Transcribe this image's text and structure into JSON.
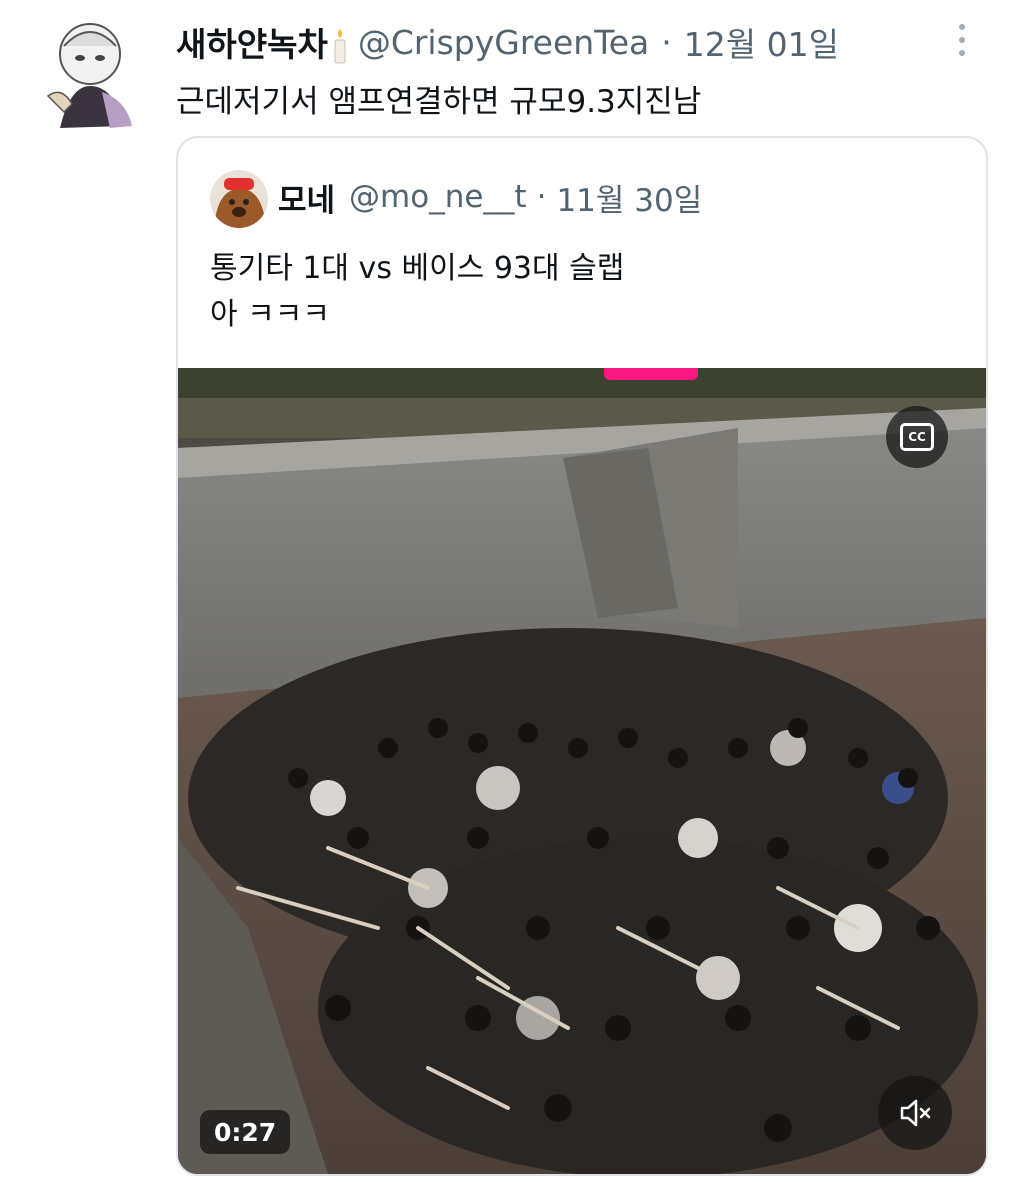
{
  "tweet": {
    "display_name": "새하얀녹차",
    "handle": "@CrispyGreenTea",
    "separator": "·",
    "date": "12월 01일",
    "text": "근데저기서 앰프연결하면 규모9.3지진남"
  },
  "quoted_tweet": {
    "display_name": "모네",
    "handle": "@mo_ne__t",
    "separator": "·",
    "date": "11월 30일",
    "text_line1": "통기타 1대 vs 베이스 93대 슬랩",
    "text_line2": "아 ㅋㅋㅋ",
    "video": {
      "duration": "0:27",
      "captions_icon": "cc-icon",
      "captions_label": "CC",
      "mute_icon": "speaker-muted-icon"
    }
  },
  "colors": {
    "text_primary": "#0f1419",
    "text_secondary": "#536471",
    "border": "#dfe3e8",
    "accent_pink": "#f91880"
  }
}
